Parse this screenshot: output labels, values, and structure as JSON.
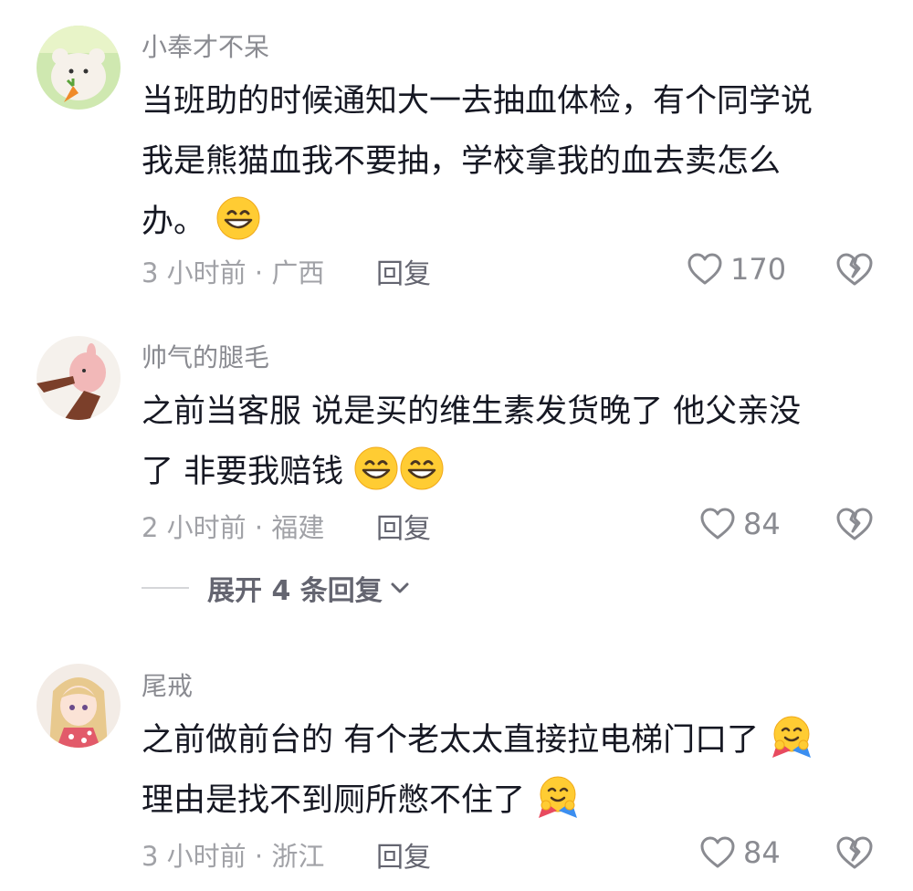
{
  "comments": [
    {
      "username": "小奉才不呆",
      "text_lines": [
        "当班助的时候通知大一去抽血体检，有个同学说",
        "我是熊猫血我不要抽，学校拿我的血去卖怎么",
        "办。"
      ],
      "emojis": [
        "grinning-face"
      ],
      "time_location": "3 小时前 · 广西",
      "reply_label": "回复",
      "like_count": "170"
    },
    {
      "username": "帅气的腿毛",
      "text_lines": [
        "之前当客服 说是买的维生素发货晚了 他父亲没",
        "了 非要我赔钱"
      ],
      "emojis": [
        "grinning-face",
        "grinning-face"
      ],
      "time_location": "2 小时前 · 福建",
      "reply_label": "回复",
      "like_count": "84"
    },
    {
      "username": "尾戒",
      "text_lines": [
        "之前做前台的 有个老太太直接拉电梯门口了",
        "理由是找不到厕所憋不住了"
      ],
      "emojis": [
        "hugging-face",
        "hugging-face"
      ],
      "time_location": "3 小时前 · 浙江",
      "reply_label": "回复",
      "like_count": "84"
    }
  ],
  "expand_replies_label": "展开 4 条回复",
  "colors": {
    "text": "#161823",
    "username": "#8a8b91",
    "meta": "#a1a2a7",
    "reply": "#646570",
    "emoji_yellow": "#ffcc33"
  }
}
